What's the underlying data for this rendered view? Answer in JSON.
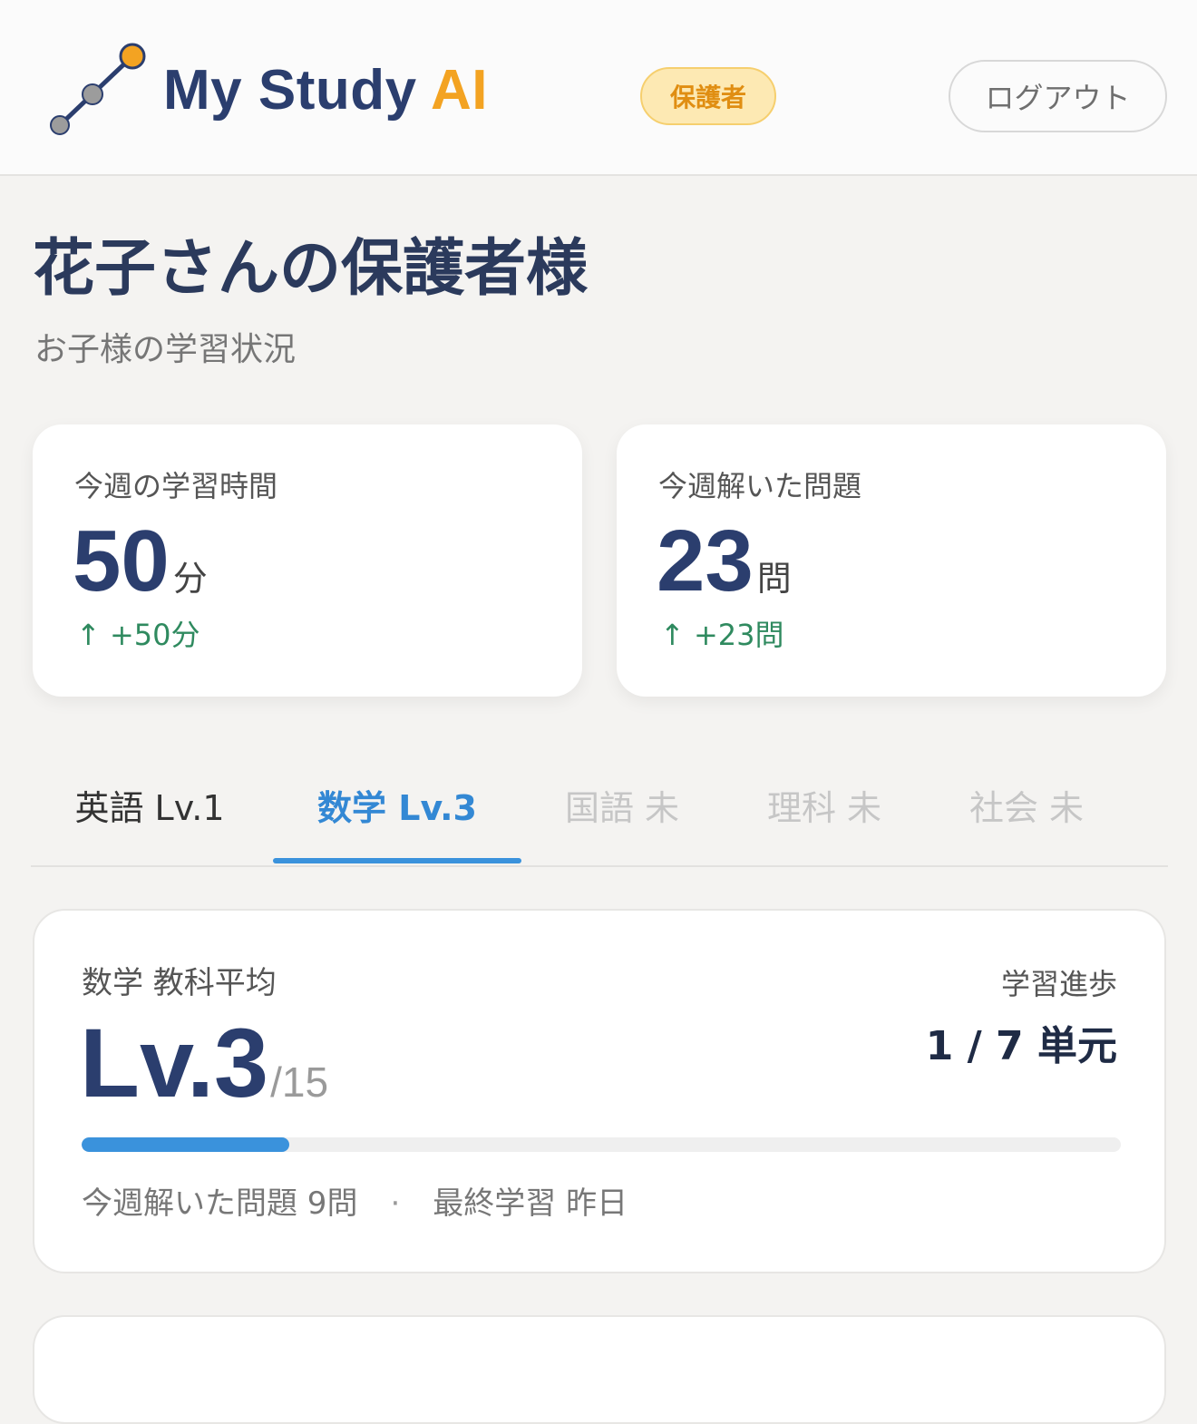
{
  "header": {
    "logo_text_main": "My Study",
    "logo_text_accent": "AI",
    "role_badge": "保護者",
    "logout_label": "ログアウト"
  },
  "page": {
    "title": "花子さんの保護者様",
    "subtitle": "お子様の学習状況"
  },
  "stats": [
    {
      "label": "今週の学習時間",
      "value": "50",
      "unit": "分",
      "delta": "↑ +50分"
    },
    {
      "label": "今週解いた問題",
      "value": "23",
      "unit": "問",
      "delta": "↑ +23問"
    }
  ],
  "tabs": [
    {
      "label": "英語 Lv.1",
      "state": "normal"
    },
    {
      "label": "数学 Lv.3",
      "state": "active"
    },
    {
      "label": "国語 未",
      "state": "disabled"
    },
    {
      "label": "理科 未",
      "state": "disabled"
    },
    {
      "label": "社会 未",
      "state": "disabled"
    }
  ],
  "subject_card": {
    "label": "数学 教科平均",
    "level": "Lv.3",
    "level_max": "/15",
    "level_value": 3,
    "level_total": 15,
    "progress_label": "学習進歩",
    "progress_value": "1 / 7 単元",
    "weekly_problems": "今週解いた問題 9問",
    "separator": "·",
    "last_study": "最終学習 昨日"
  },
  "colors": {
    "brand_navy": "#2b3e6e",
    "brand_orange": "#f3a322",
    "accent_blue": "#3a92dc",
    "positive_green": "#2f8a5f"
  }
}
